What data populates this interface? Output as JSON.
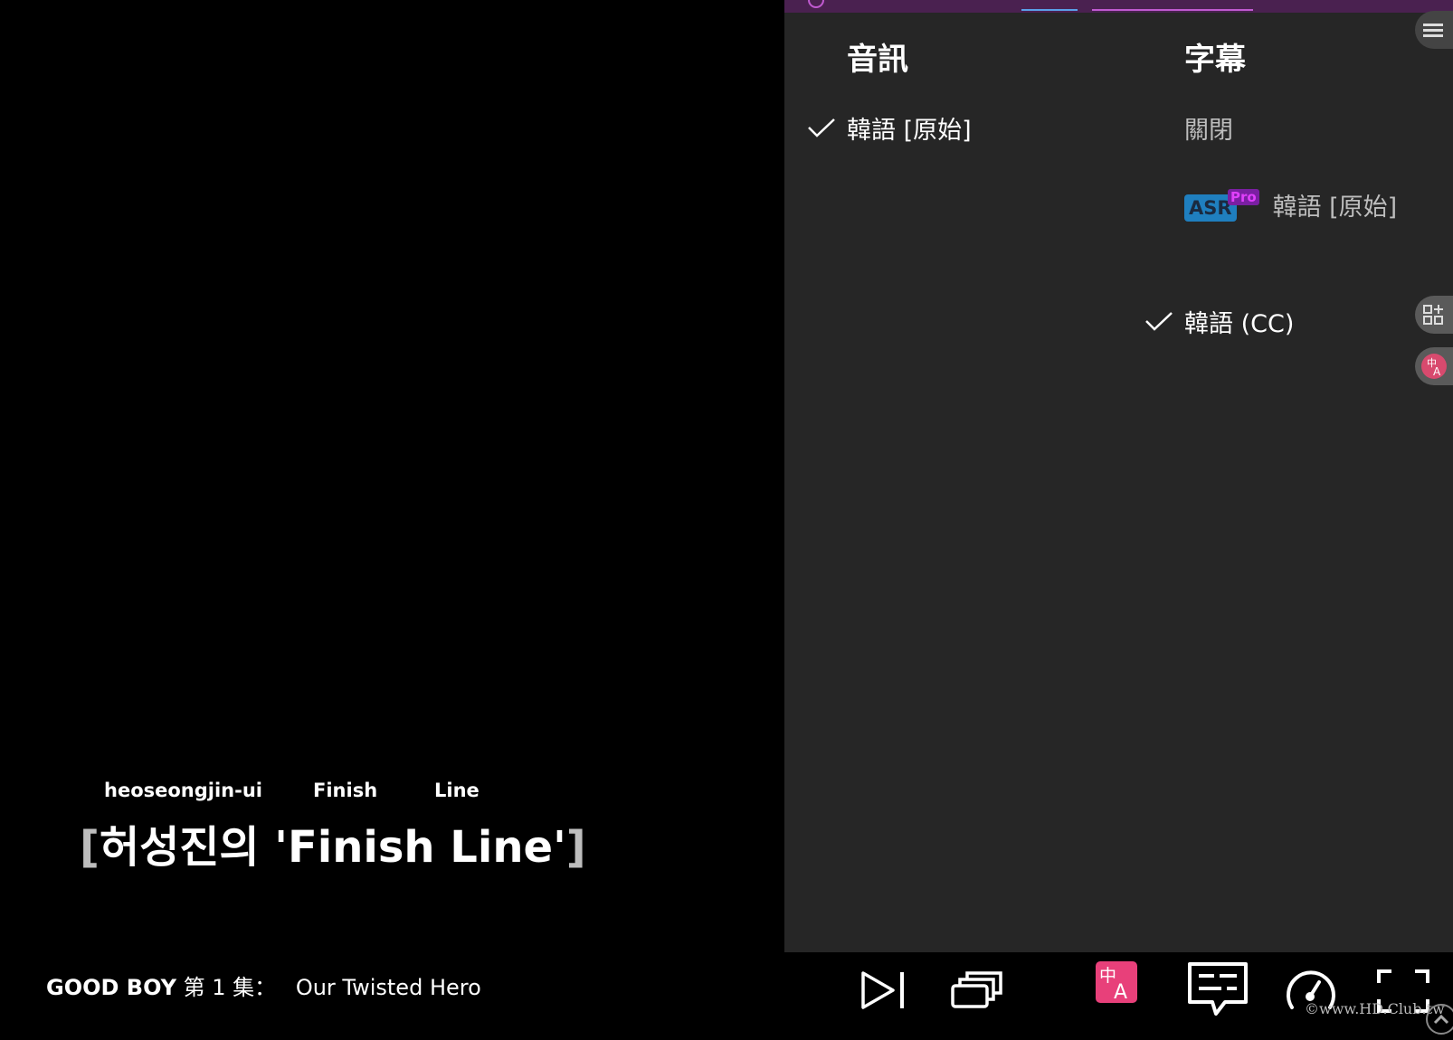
{
  "subtitle": {
    "romaji": [
      "heoseongjin-ui",
      "Finish",
      "Line"
    ],
    "open_bracket": "[",
    "main": "허성진의 'Finish Line'",
    "close_bracket": "]"
  },
  "episode": {
    "show": "GOOD BOY",
    "episode_label": "第 1 集：",
    "episode_name": "Our Twisted Hero"
  },
  "panel": {
    "audio_title": "音訊",
    "subtitle_title": "字幕",
    "audio_options": [
      {
        "label": "韓語 [原始]",
        "selected": true
      }
    ],
    "subtitle_options": {
      "off": {
        "label": "關閉",
        "selected": false
      },
      "asr": {
        "badge": "ASR",
        "pro": "Pro",
        "label": "韓語 [原始]",
        "selected": false
      },
      "cc": {
        "label": "韓語 (CC)",
        "selected": true
      }
    }
  },
  "controls": {
    "icons": [
      "next-episode-icon",
      "episodes-icon",
      "translate-icon",
      "subtitles-icon",
      "playback-speed-icon",
      "fullscreen-icon"
    ],
    "translate_icon_color": "#e8407a"
  },
  "watermark": "©www.HD.Club.tw",
  "colors": {
    "panel_bg": "#262626",
    "topbar_bg": "#4a2150",
    "asr_badge": "#1f7fbf",
    "pro_badge": "#7a1fa2"
  }
}
